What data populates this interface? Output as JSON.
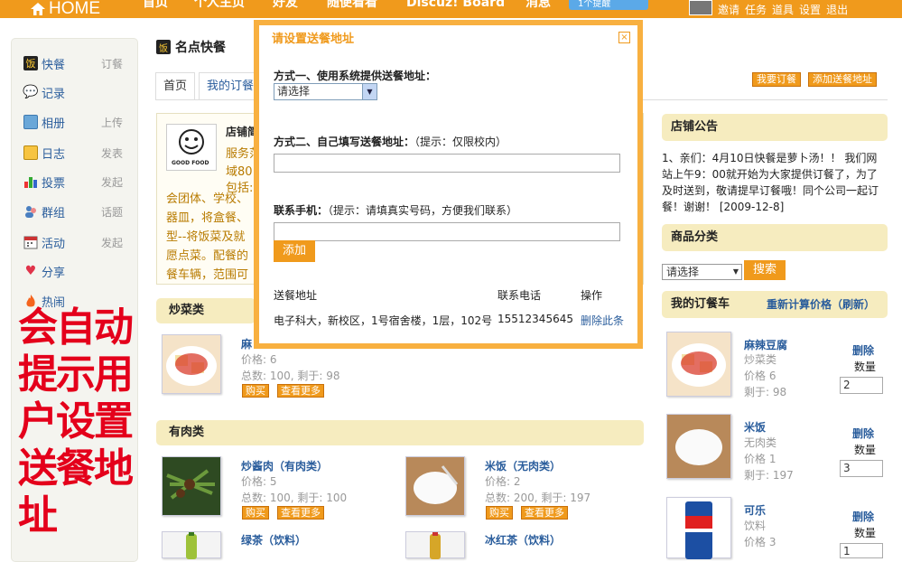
{
  "topbar": {
    "home_label": "HOME",
    "nav": [
      "首页",
      "个人主页",
      "好友",
      "随便看看",
      "Discuz! Board",
      "消息"
    ],
    "remind_label": "1个提醒",
    "user_links": [
      "邀请",
      "任务",
      "道具",
      "设置",
      "退出"
    ]
  },
  "sidebar": {
    "items": [
      {
        "label": "快餐",
        "action": "订餐",
        "icon": "fastfood-icon"
      },
      {
        "label": "记录",
        "action": "",
        "icon": "chat-bubble-icon"
      },
      {
        "label": "相册",
        "action": "上传",
        "icon": "photo-album-icon"
      },
      {
        "label": "日志",
        "action": "发表",
        "icon": "blog-icon"
      },
      {
        "label": "投票",
        "action": "发起",
        "icon": "poll-icon"
      },
      {
        "label": "群组",
        "action": "话题",
        "icon": "group-icon"
      },
      {
        "label": "活动",
        "action": "发起",
        "icon": "calendar-icon"
      },
      {
        "label": "分享",
        "action": "",
        "icon": "heart-icon"
      },
      {
        "label": "热闹",
        "action": "",
        "icon": "fire-icon"
      }
    ]
  },
  "annotation": {
    "text": "会自动提示用户设置送餐地址"
  },
  "page": {
    "title_icon_char": "饭",
    "title": "名点快餐",
    "tabs": [
      "首页",
      "我的订餐"
    ],
    "order_btn": "我要订餐",
    "add_addr_btn": "添加送餐地址"
  },
  "shop": {
    "logo_text": "GOOD FOOD",
    "name_partial": "店铺简",
    "lines_right": [
      "服务范",
      "域80",
      "包括:"
    ],
    "text_lines": [
      "会团体、学校、",
      "器皿，将盒餐、",
      "型--将饭菜及就",
      "愿点菜。配餐的",
      "餐车辆，范围可"
    ]
  },
  "sections": [
    {
      "title": "炒菜类",
      "products": [
        {
          "name": "麻",
          "price": "价格: 6",
          "stock": "总数: 100, 剩于: 98"
        }
      ]
    },
    {
      "title": "有肉类",
      "products": [
        {
          "name": "炒酱肉（有肉类）",
          "price": "价格: 5",
          "stock": "总数: 100, 剩于: 100"
        },
        {
          "name": "米饭（无肉类）",
          "price": "价格: 2",
          "stock": "总数: 200, 剩于: 197"
        },
        {
          "name": "绿茶（饮料）",
          "price": "",
          "stock": ""
        },
        {
          "name": "冰红茶（饮料）",
          "price": "",
          "stock": ""
        }
      ]
    }
  ],
  "buy_btn": "购买",
  "more_btn": "查看更多",
  "right": {
    "notice_title": "店铺公告",
    "notice_text": "1、亲们：4月10日快餐是萝卜汤！！ 我们网站上午9：00就开始为大家提供订餐了，为了及时送到，敬请提早订餐哦！同个公司一起订餐！谢谢！ [2009-12-8]",
    "category_title": "商品分类",
    "select_placeholder": "请选择",
    "search_btn": "搜索",
    "cart_title": "我的订餐车",
    "recalc": "重新计算价格（刷新）",
    "cart_items": [
      {
        "name": "麻辣豆腐",
        "type": "炒菜类",
        "price": "价格 6",
        "remain": "剩于: 98",
        "qty": "2"
      },
      {
        "name": "米饭",
        "type": "无肉类",
        "price": "价格 1",
        "remain": "剩于: 197",
        "qty": "3"
      },
      {
        "name": "可乐",
        "type": "饮料",
        "price": "价格 3",
        "remain": "",
        "qty": "1"
      }
    ],
    "delete_label": "删除",
    "qty_label": "数量"
  },
  "modal": {
    "title": "请设置送餐地址",
    "close_char": "×",
    "method1_label": "方式一、使用系统提供送餐地址：",
    "select_value": "请选择",
    "method2_label": "方式二、自己填写送餐地址：",
    "method2_hint": "（提示：仅限校内）",
    "phone_label": "联系手机：",
    "phone_hint": "（提示：请填真实号码，方便我们联系）",
    "add_btn": "添加",
    "col_address": "送餐地址",
    "col_phone": "联系电话",
    "col_action": "操作",
    "row_address": "电子科大，新校区，1号宿舍楼，1层，102号",
    "row_phone": "15512345645",
    "row_delete": "删除此条"
  },
  "colors": {
    "accent": "#f09a1c",
    "link": "#2a5d9c",
    "annotation": "#e4001b",
    "section_bg": "#f6ecbf"
  }
}
